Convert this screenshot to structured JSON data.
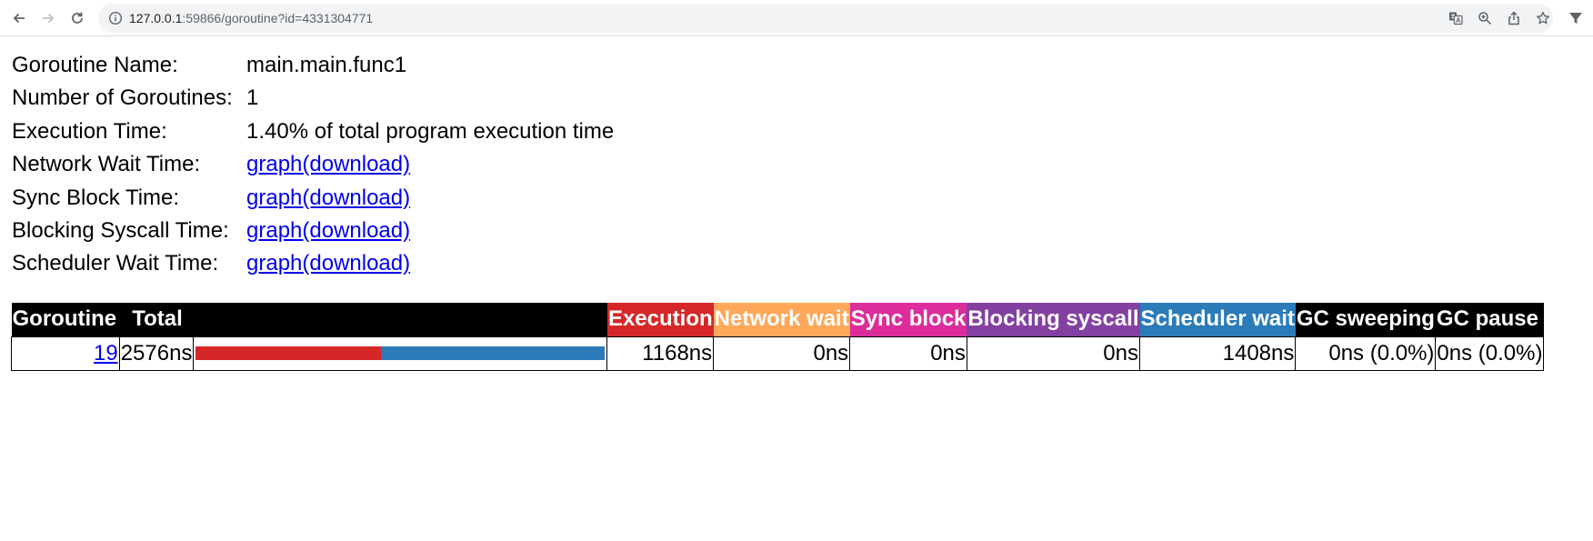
{
  "browser": {
    "url_host": "127.0.0.1",
    "url_path": ":59866/goroutine?id=4331304771"
  },
  "summary": {
    "rows": [
      {
        "label": "Goroutine Name:",
        "value": "main.main.func1"
      },
      {
        "label": "Number of Goroutines:",
        "value": "1"
      },
      {
        "label": "Execution Time:",
        "value": "1.40% of total program execution time"
      },
      {
        "label": "Network Wait Time:",
        "link": "graph(download)"
      },
      {
        "label": "Sync Block Time:",
        "link": "graph(download)"
      },
      {
        "label": "Blocking Syscall Time:",
        "link": "graph(download)"
      },
      {
        "label": "Scheduler Wait Time:",
        "link": "graph(download)"
      }
    ]
  },
  "table": {
    "headers": [
      {
        "label": "Goroutine",
        "color": "#000000"
      },
      {
        "label": "Total",
        "color": "#000000"
      },
      {
        "label": "",
        "color": "#000000"
      },
      {
        "label": "Execution",
        "color": "#d62728"
      },
      {
        "label": "Network wait",
        "color": "#ffa85a"
      },
      {
        "label": "Sync block",
        "color": "#dc2d9b"
      },
      {
        "label": "Blocking syscall",
        "color": "#8340a1"
      },
      {
        "label": "Scheduler wait",
        "color": "#2b7bb9"
      },
      {
        "label": "GC sweeping",
        "color": "#000000"
      },
      {
        "label": "GC pause",
        "color": "#000000"
      }
    ],
    "row": {
      "goroutine": "19",
      "total": "2576ns",
      "bar": [
        {
          "name": "execution",
          "fraction": 0.4534,
          "color": "#d62728"
        },
        {
          "name": "scheduler-wait",
          "fraction": 0.5466,
          "color": "#2b7bb9"
        }
      ],
      "execution": "1168ns",
      "network_wait": "0ns",
      "sync_block": "0ns",
      "blocking_syscall": "0ns",
      "scheduler_wait": "1408ns",
      "gc_sweeping": "0ns (0.0%)",
      "gc_pause": "0ns (0.0%)"
    }
  }
}
